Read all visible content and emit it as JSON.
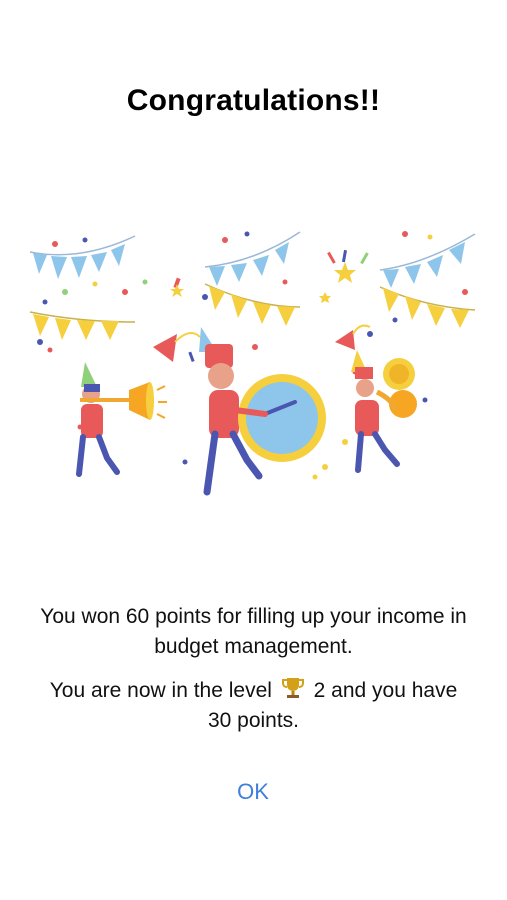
{
  "dialog": {
    "title": "Congratulations!!",
    "illustration_icon": "celebration-parade-illustration",
    "message": "You won 60 points for filling up your income in budget management.",
    "level_prefix": "You are now in the level",
    "level_icon": "trophy-icon",
    "level_value": "2",
    "level_middle": "and you have",
    "points_line": "30 points.",
    "ok_label": "OK"
  },
  "colors": {
    "accent": "#3f7fdc",
    "flag_blue": "#8ec5ea",
    "flag_yellow": "#f6cf3f",
    "uniform_red": "#e85a5a",
    "legs_blue": "#4a56b0"
  }
}
